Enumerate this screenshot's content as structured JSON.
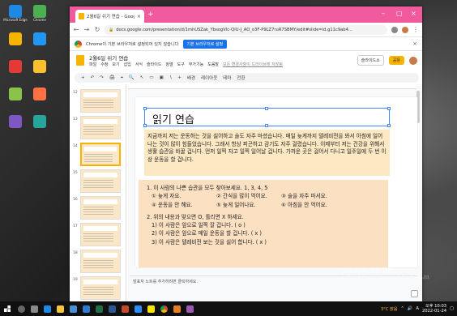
{
  "desktop": {
    "icons": [
      {
        "label": "Microsoft Edge",
        "color": "#1e88e5"
      },
      {
        "label": "Chrome",
        "color": "#4caf50"
      },
      {
        "label": "",
        "color": "#f4b400"
      },
      {
        "label": "",
        "color": "#2196f3"
      },
      {
        "label": "",
        "color": "#e53935"
      },
      {
        "label": "",
        "color": "#fbc02d"
      },
      {
        "label": "",
        "color": "#8bc34a"
      },
      {
        "label": "",
        "color": "#ff7043"
      },
      {
        "label": "",
        "color": "#7e57c2"
      },
      {
        "label": "",
        "color": "#26a69a"
      }
    ],
    "activation": {
      "line1": "Windows 정품 인증",
      "line2": "[설정]으로 이동하여 Windows를 정품 인증합니다."
    }
  },
  "browser": {
    "tab_title": "2월6일 쉬기 연습 - Google Slides",
    "url": "docs.google.com/presentation/d/1mhUSZak_YbsogVlc-QlU-J_AO_o3F-P9LZ7ruR7SBMY/edit#slide=id.g11c9ab4...",
    "infobar_message": "Chrome이 기본 브라우저로 설정되어 있지 않습니다",
    "infobar_button": "기본 브라우저로 설정",
    "accent": "#f25a9e"
  },
  "app": {
    "doc_title": "2월6일 쉬기 연습",
    "menus": [
      "파일",
      "수정",
      "보기",
      "삽입",
      "서식",
      "슬라이드",
      "정렬",
      "도구",
      "부가기능",
      "도움말"
    ],
    "saved_status": "모든 변경사항이 드라이브에 저장됨",
    "slideshow_label": "슬라이드쇼",
    "share_label": "공유",
    "toolbar_items": [
      "+",
      "↶",
      "↷",
      "🖨",
      "⌖",
      "🔍",
      "↖",
      "▭",
      "▣",
      "∖",
      "+",
      "배경",
      "레이아웃",
      "테마",
      "전환"
    ],
    "notes_placeholder": "발표자 노트를 추가하려면 클릭하세요."
  },
  "filmstrip": {
    "slides": [
      {
        "num": "12"
      },
      {
        "num": "13"
      },
      {
        "num": "14"
      },
      {
        "num": "15"
      },
      {
        "num": "16"
      },
      {
        "num": "17"
      },
      {
        "num": "18"
      },
      {
        "num": "19"
      }
    ],
    "selected_index": 2
  },
  "slide": {
    "title": "읽기 연습",
    "passage": "지금까지 저는 운동하는 것을 싫어하고 술도 자주 마셨습니다. 매일 늦게까지 텔레비전을 봐서 아침에 일어나는 것이 많이 힘들었습니다. 그래서 항상 피곤하고 감기도 자주 걸렸습니다. 이제부터 저는 건강을 위해서 생활 습관을 바꿀 겁니다. 먼저 일찍 자고 일찍 일어날 겁니다. 가까운 곳은 걸어서 다니고 일주일에 두 번 이상 운동을 할 겁니다.",
    "q1_prompt": "1. 이 사람의 나쁜 습관을 모두 찾아보세요. 1, 3, 4, 5",
    "q1_options": [
      "① 늦게 자요.",
      "② 간식을 많이 먹어요.",
      "③ 술을 자주 마셔요.",
      "④ 운동을 안 해요.",
      "⑤ 늦게 일어나요.",
      "⑥ 아침을 안 먹어요."
    ],
    "q2_prompt": "2. 위의 내용과 맞으면 O, 틀리면 X 하세요.",
    "q2_items": [
      "1) 이 사람은 앞으로 일찍 잘 겁니다. (   o   )",
      "2) 이 사람은 앞으로 매일 운동을 할 겁니다. ( x )",
      "3) 이 사람은 텔레비전 보는 것을 싫어 합니다. ( x )"
    ]
  },
  "taskbar": {
    "weather": "3°C 맑음",
    "ime": "A",
    "time": "오후 10:03",
    "date": "2022-01-24"
  }
}
